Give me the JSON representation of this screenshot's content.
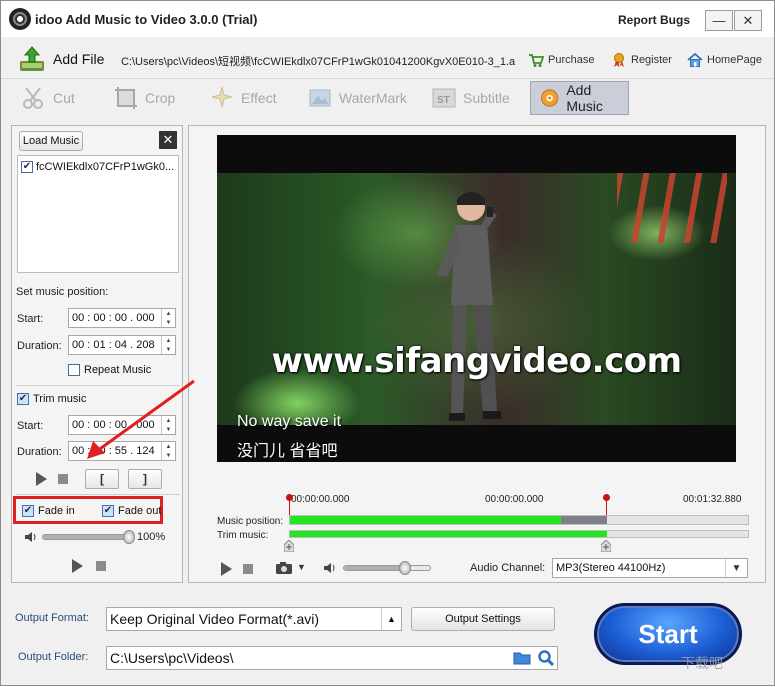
{
  "window": {
    "title": "idoo Add Music to Video 3.0.0 (Trial)",
    "report_bugs": "Report Bugs",
    "minimize": "—",
    "close": "✕"
  },
  "addr_row": {
    "add_file": "Add File",
    "path": "C:\\Users\\pc\\Videos\\短视频\\fcCWIEkdlx07CFrP1wGk01041200KgvX0E010-3_1.a",
    "links": {
      "purchase": "Purchase",
      "register": "Register",
      "homepage": "HomePage"
    }
  },
  "tools": {
    "cut": "Cut",
    "crop": "Crop",
    "effect": "Effect",
    "watermark": "WaterMark",
    "subtitle": "Subtitle",
    "add_music": "Add Music",
    "active": "add_music"
  },
  "left_panel": {
    "load_music": "Load Music",
    "close": "✕",
    "music_items": [
      {
        "name": "fcCWIEkdlx07CFrP1wGk0...",
        "checked": true
      }
    ],
    "set_music_position": "Set music position:",
    "start_label": "Start:",
    "start_value": "00 : 00 : 00 . 000",
    "duration_label": "Duration:",
    "duration_value": "00 : 01 : 04 . 208",
    "repeat_music": "Repeat Music",
    "trim_music": "Trim music",
    "trim_start_label": "Start:",
    "trim_start_value": "00 : 00 : 00 . 000",
    "trim_duration_label": "Duration:",
    "trim_duration_value": "00 : 00 : 55 . 124",
    "bracket_in": "[",
    "bracket_out": "]",
    "fade_in": "Fade in",
    "fade_out": "Fade out",
    "volume_percent": "100%",
    "volume_fraction": 1.0
  },
  "video": {
    "watermark_text": "www.sifangvideo.com",
    "subtitle_en": "No way save it",
    "subtitle_cn": "没门儿 省省吧"
  },
  "timeline": {
    "time_start": "00:00:00.000",
    "time_mid": "00:00:00.000",
    "time_end": "00:01:32.880",
    "music_position_label": "Music position:",
    "trim_music_label": "Trim music:",
    "music_green_fraction": 0.59,
    "music_total_fraction": 0.69,
    "trim_green_fraction": 0.69
  },
  "controls": {
    "audio_channel_label": "Audio Channel:",
    "audio_channel_value": "MP3(Stereo 44100Hz)",
    "player_volume_fraction": 0.72
  },
  "bottom": {
    "output_format_label": "Output Format:",
    "output_format_value": "Keep Original Video Format(*.avi)",
    "output_settings": "Output Settings",
    "output_folder_label": "Output Folder:",
    "output_folder_value": "C:\\Users\\pc\\Videos\\",
    "start": "Start",
    "brand_watermark": "下载吧"
  },
  "colors": {
    "progress_green": "#22e622",
    "marker_red": "#d01010",
    "annotation_red": "#e02020",
    "start_blue": "#1d5fd6"
  }
}
